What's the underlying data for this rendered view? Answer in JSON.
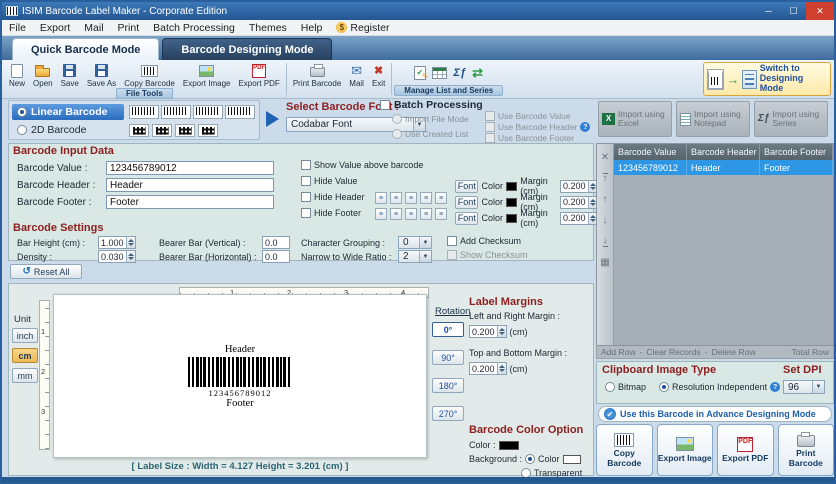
{
  "window": {
    "title": "ISIM Barcode Label Maker - Corporate Edition"
  },
  "menu": {
    "items": [
      "File",
      "Export",
      "Mail",
      "Print",
      "Batch Processing",
      "Themes",
      "Help",
      "Register"
    ]
  },
  "tabs": {
    "quick": "Quick Barcode Mode",
    "designing": "Barcode Designing Mode"
  },
  "toolbar": {
    "items": [
      "New",
      "Open",
      "Save",
      "Save As",
      "Copy Barcode",
      "Export Image",
      "Export PDF",
      "Print Barcode",
      "Mail",
      "Exit"
    ],
    "file_tools_caption": "File Tools",
    "manage_caption": "Manage List and Series",
    "switch_button": "Switch to Designing Mode"
  },
  "barcode_type": {
    "linear": "Linear Barcode",
    "two_d": "2D Barcode"
  },
  "font_section": {
    "label": "Select Barcode Font :",
    "selected": "Codabar Font"
  },
  "batch": {
    "title": "Batch Processing",
    "import_file_mode": "Import File Mode",
    "use_created_list": "Use Created List",
    "use_barcode_value": "Use Barcode Value",
    "use_barcode_header": "Use Barcode Header",
    "use_barcode_footer": "Use Barcode Footer"
  },
  "imports": {
    "excel": "Import using Excel",
    "notepad": "Import using Notepad",
    "series": "Import using Series"
  },
  "input_data": {
    "title": "Barcode Input Data",
    "value_label": "Barcode Value :",
    "value": "123456789012",
    "header_label": "Barcode Header :",
    "header": "Header",
    "footer_label": "Barcode Footer :",
    "footer": "Footer",
    "show_value_above": "Show Value above barcode",
    "hide_value": "Hide Value",
    "hide_header": "Hide Header",
    "hide_footer": "Hide Footer",
    "font_button": "Font",
    "color_label": "Color",
    "margin_label": "Margin (cm)",
    "margin_value": "0.200"
  },
  "settings": {
    "title": "Barcode Settings",
    "bar_height_label": "Bar Height (cm) :",
    "bar_height": "1.000",
    "density_label": "Density :",
    "density": "0.030",
    "bearer_vertical_label": "Bearer Bar (Vertical) :",
    "bearer_vertical": "0.0",
    "bearer_horizontal_label": "Bearer Bar (Horizontal) :",
    "bearer_horizontal": "0.0",
    "char_grouping_label": "Character Grouping :",
    "char_grouping": "0",
    "ratio_label": "Narrow to Wide Ratio :",
    "ratio": "2",
    "add_checksum": "Add Checksum",
    "show_checksum": "Show Checksum",
    "reset_all": "Reset All"
  },
  "preview": {
    "unit_label": "Unit",
    "units": [
      "inch",
      "cm",
      "mm"
    ],
    "ruler_h": [
      "1",
      "2",
      "3",
      "4"
    ],
    "ruler_v": [
      "1",
      "2",
      "3"
    ],
    "rotation_label": "Rotation",
    "rotations": [
      "0°",
      "90°",
      "180°",
      "270°"
    ],
    "status": "[ Label Size : Width = 4.127  Height = 3.201 (cm) ]"
  },
  "barcode": {
    "header": "Header",
    "value": "123456789012",
    "footer": "Footer"
  },
  "margins": {
    "title": "Label Margins",
    "lr_label": "Left and Right Margin :",
    "lr_value": "0.200",
    "tb_label": "Top and Bottom Margin :",
    "tb_value": "0.200",
    "unit": "(cm)"
  },
  "color_option": {
    "title": "Barcode Color Option",
    "color_label": "Color :",
    "background_label": "Background :",
    "color_radio": "Color",
    "transparent_radio": "Transparent",
    "barcode_color": "#000000",
    "background_color": "#ffffff"
  },
  "table": {
    "headers": [
      "Barcode Value",
      "Barcode Header",
      "Barcode Footer"
    ],
    "rows": [
      [
        "123456789012",
        "Header",
        "Footer"
      ]
    ]
  },
  "records": {
    "add_row": "Add Row",
    "sep": "-",
    "clear_records": "Clear Records",
    "delete_row": "Delete Row",
    "total_row": "Total Row"
  },
  "clipboard": {
    "title": "Clipboard Image Type",
    "bitmap": "Bitmap",
    "resolution_independent": "Resolution Independent",
    "set_dpi_label": "Set DPI",
    "dpi": "96"
  },
  "advance": {
    "link": "Use this Barcode in Advance Designing Mode"
  },
  "actions": {
    "copy": "Copy Barcode",
    "export_image": "Export Image",
    "export_pdf": "Export PDF",
    "print": "Print Barcode"
  },
  "colors": {
    "titlebar": "#235693",
    "selected_row": "#2e97e5",
    "group_title": "#8e2020",
    "accent": "#2a6cbd"
  }
}
